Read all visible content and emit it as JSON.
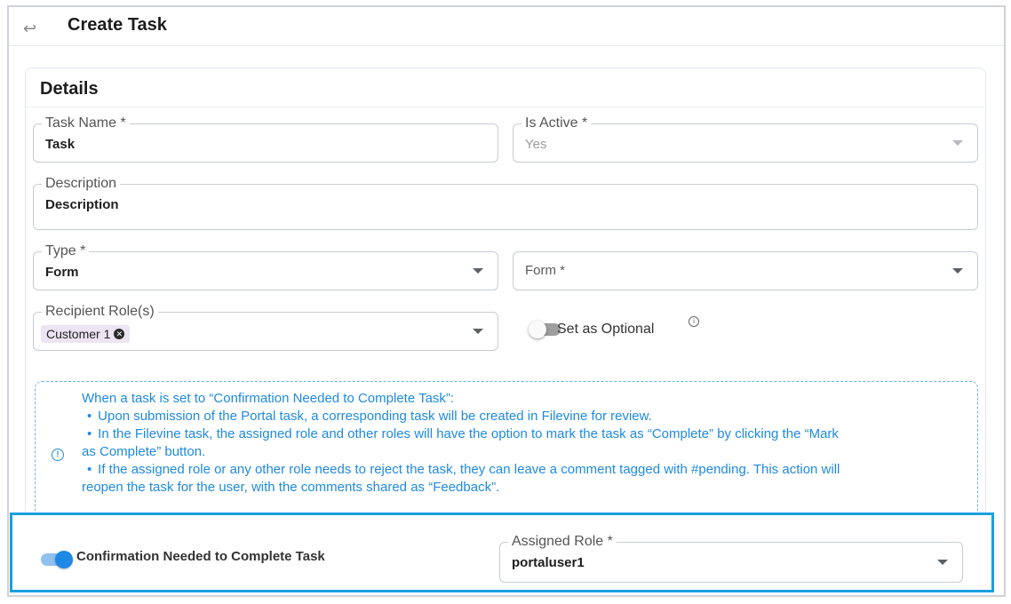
{
  "header": {
    "title": "Create Task"
  },
  "details": {
    "title": "Details",
    "task_name": {
      "label": "Task Name *",
      "value": "Task"
    },
    "is_active": {
      "label": "Is Active *",
      "value": "Yes"
    },
    "description": {
      "label": "Description",
      "value": "Description"
    },
    "type": {
      "label": "Type *",
      "value": "Form"
    },
    "form": {
      "placeholder": "Form *"
    },
    "recipient_roles": {
      "label": "Recipient Role(s)",
      "chips": [
        "Customer 1"
      ]
    },
    "set_optional": {
      "label": "Set as Optional",
      "on": false
    }
  },
  "info": {
    "intro": "When a task is set to “Confirmation Needed to Complete Task”:",
    "bullets": [
      "Upon submission of the Portal task, a corresponding task will be created in Filevine for review.",
      "In the Filevine task, the assigned role and other roles will have the option to mark the task as “Complete” by clicking the “Mark",
      "If the assigned role or any other role needs to reject the task, they can leave a comment tagged with #pending. This action will"
    ],
    "continuations": [
      "as Complete” button.",
      "reopen the task for the user, with the comments shared as “Feedback”."
    ],
    "bullet_char": "•"
  },
  "confirmation": {
    "label": "Confirmation Needed to Complete Task",
    "on": true,
    "assigned_role": {
      "label": "Assigned Role *",
      "value": "portaluser1"
    }
  },
  "colors": {
    "accent": "#1e88e5",
    "highlight": "#1aa0e0",
    "info_text": "#1f8ae0"
  },
  "icons": {
    "back": "back-arrow-icon",
    "info": "info-icon",
    "chip_remove": "close-circle-icon",
    "dropdown": "chevron-down-icon"
  }
}
